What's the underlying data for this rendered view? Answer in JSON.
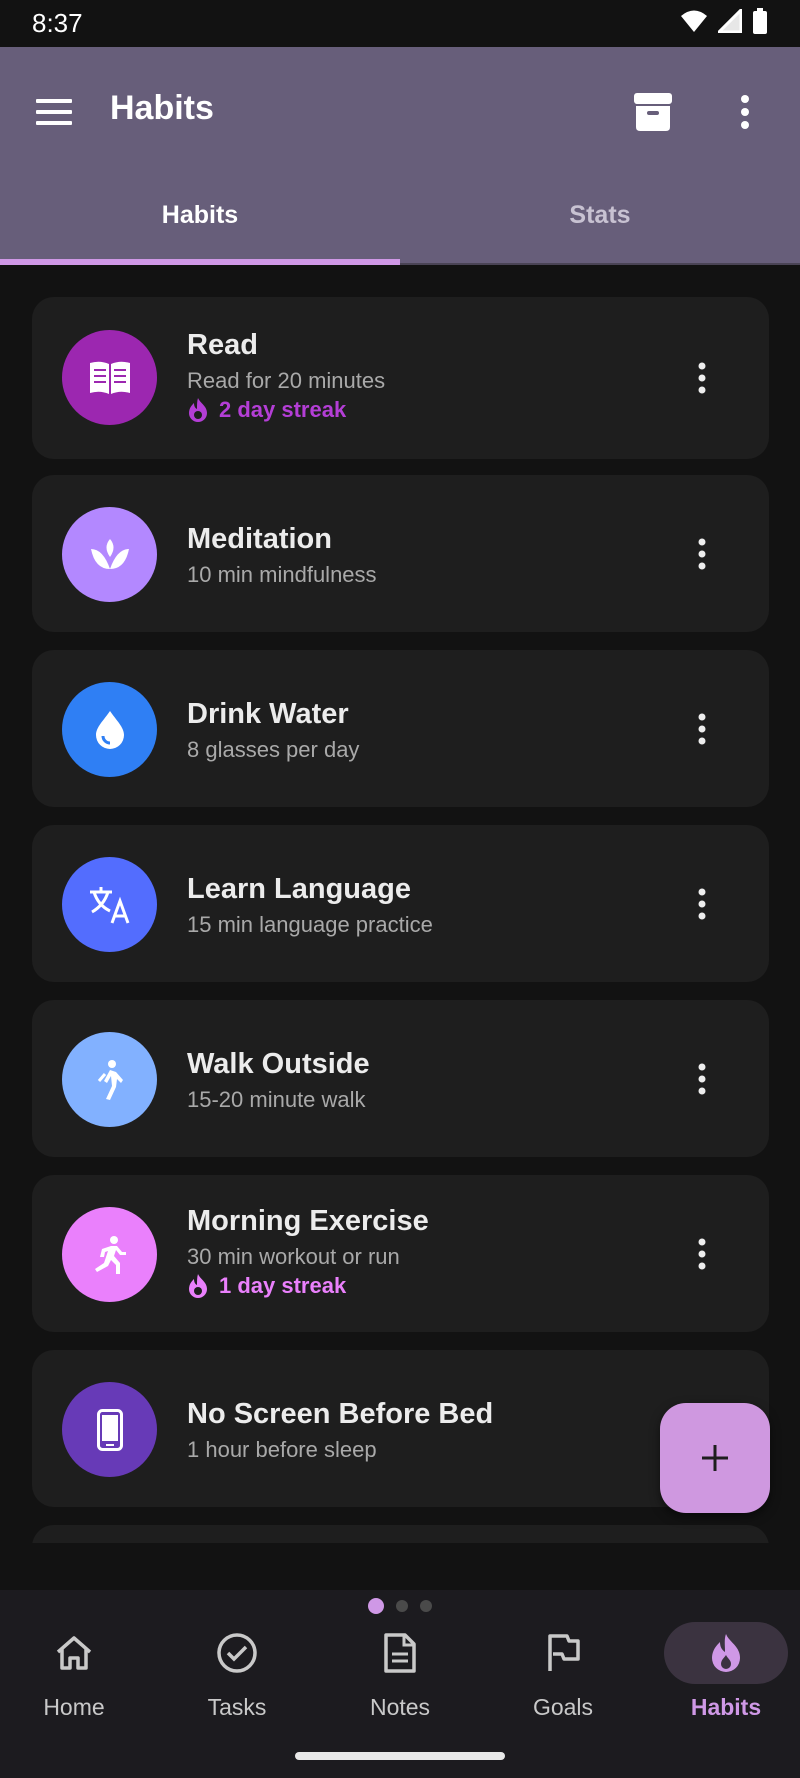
{
  "status_bar": {
    "time": "8:37"
  },
  "app_bar": {
    "title": "Habits"
  },
  "tabs": [
    {
      "label": "Habits",
      "selected": true
    },
    {
      "label": "Stats",
      "selected": false
    }
  ],
  "colors": {
    "accent": "#cf98e6",
    "app_bar": "#675e7a",
    "background": "#121212",
    "card": "#1e1e1e"
  },
  "habits": [
    {
      "name": "Read",
      "description": "Read for 20 minutes",
      "streak": "2 day streak",
      "streak_color": "#b43ed6",
      "icon": "book-icon",
      "icon_bg": "#9c27b0"
    },
    {
      "name": "Meditation",
      "description": "10 min mindfulness",
      "icon": "lotus-icon",
      "icon_bg": "#b388ff"
    },
    {
      "name": "Drink Water",
      "description": "8 glasses per day",
      "icon": "water-drop-icon",
      "icon_bg": "#2f7ff4"
    },
    {
      "name": "Learn Language",
      "description": "15 min language practice",
      "icon": "translate-icon",
      "icon_bg": "#536dfe"
    },
    {
      "name": "Walk Outside",
      "description": "15-20 minute walk",
      "icon": "walk-icon",
      "icon_bg": "#82b1ff"
    },
    {
      "name": "Morning Exercise",
      "description": "30 min workout or run",
      "streak": "1 day streak",
      "streak_color": "#ea80fc",
      "icon": "run-icon",
      "icon_bg": "#ea80fc"
    },
    {
      "name": "No Screen Before Bed",
      "description": "1 hour before sleep",
      "icon": "smartphone-icon",
      "icon_bg": "#673ab7"
    }
  ],
  "fab": {
    "icon": "plus-icon"
  },
  "bottom_nav": [
    {
      "label": "Home",
      "icon": "home-icon"
    },
    {
      "label": "Tasks",
      "icon": "check-circle-icon"
    },
    {
      "label": "Notes",
      "icon": "document-icon"
    },
    {
      "label": "Goals",
      "icon": "flag-icon"
    },
    {
      "label": "Habits",
      "icon": "flame-icon",
      "selected": true
    }
  ],
  "pager": {
    "pages": 3,
    "current": 1
  }
}
